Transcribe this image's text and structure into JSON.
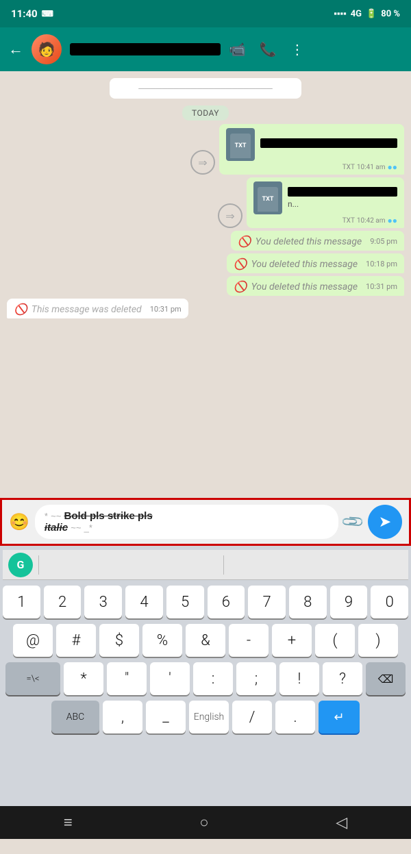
{
  "statusBar": {
    "time": "11:40",
    "signal": "4G",
    "battery": "80 %"
  },
  "header": {
    "backLabel": "←",
    "contactName": "REDACTED",
    "videoCallIcon": "📹",
    "callIcon": "📞",
    "menuIcon": "⋮"
  },
  "chat": {
    "todayLabel": "TODAY",
    "messages": [
      {
        "type": "file-sent",
        "fileType": "TXT",
        "time": "10:41 am",
        "ticks": "●●"
      },
      {
        "type": "file-sent",
        "fileType": "TXT",
        "time": "10:42 am",
        "ticks": "●●"
      },
      {
        "type": "deleted-sent",
        "text": "You deleted this message",
        "time": "9:05 pm"
      },
      {
        "type": "deleted-sent",
        "text": "You deleted this message",
        "time": "10:18 pm"
      },
      {
        "type": "deleted-sent",
        "text": "You deleted this message",
        "time": "10:31 pm"
      },
      {
        "type": "deleted-received",
        "text": "This message was deleted",
        "time": "10:31 pm"
      }
    ]
  },
  "inputArea": {
    "emojiIcon": "😊",
    "attachIcon": "📎",
    "inputText": "* ~~ Bold pls strike pls italic ~~ _*",
    "sendIcon": "➤"
  },
  "keyboard": {
    "suggestions": [
      "",
      "",
      ""
    ],
    "rows": [
      [
        "1",
        "2",
        "3",
        "4",
        "5",
        "6",
        "7",
        "8",
        "9",
        "0"
      ],
      [
        "@",
        "#",
        "$",
        "%",
        "&",
        "-",
        "+",
        "(",
        ")"
      ],
      [
        "=\\<",
        "*",
        "\"",
        "'",
        ":",
        ";",
        "!",
        "?",
        "⌫"
      ],
      [
        "ABC",
        ",",
        "_",
        "English",
        "/",
        ".",
        "↵"
      ]
    ]
  },
  "navBar": {
    "menuIcon": "≡",
    "homeIcon": "○",
    "backIcon": "◁"
  }
}
